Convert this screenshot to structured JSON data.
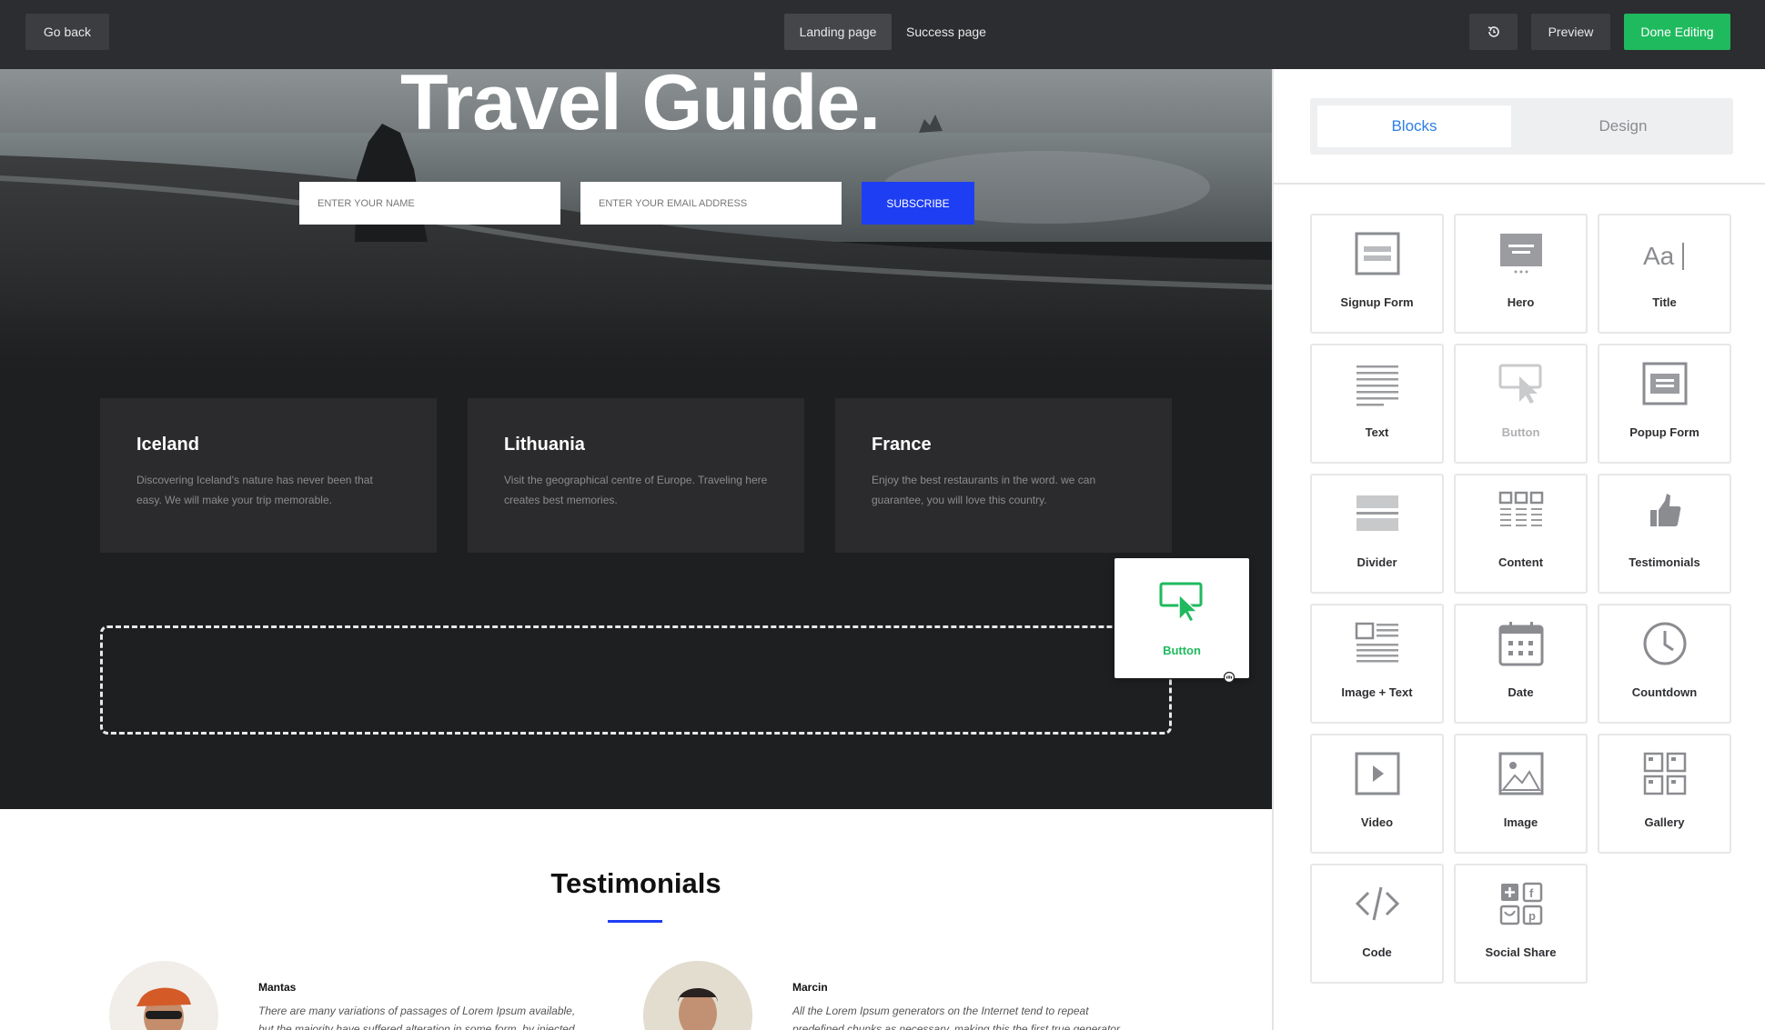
{
  "topbar": {
    "go_back": "Go back",
    "tabs": [
      {
        "label": "Landing page",
        "active": true
      },
      {
        "label": "Success page",
        "active": false
      }
    ],
    "history_icon": "history-icon",
    "preview": "Preview",
    "done": "Done Editing"
  },
  "hero": {
    "title": "Travel Guide.",
    "name_placeholder": "ENTER YOUR NAME",
    "email_placeholder": "ENTER YOUR EMAIL ADDRESS",
    "subscribe": "SUBSCRIBE"
  },
  "cards": [
    {
      "title": "Iceland",
      "text": "Discovering Iceland's nature has never been that easy. We will make your trip memorable."
    },
    {
      "title": "Lithuania",
      "text": "Visit the geographical centre of Europe. Traveling here creates best memories."
    },
    {
      "title": "France",
      "text": "Enjoy the best restaurants in the word. we can guarantee, you will love this country."
    }
  ],
  "drag": {
    "label": "Button",
    "icon": "cursor-click-icon"
  },
  "testimonials": {
    "title": "Testimonials",
    "items": [
      {
        "name": "Mantas",
        "text": "There are many variations of passages of Lorem Ipsum available, but the majority have suffered alteration in some form, by injected humour"
      },
      {
        "name": "Marcin",
        "text": "All the Lorem Ipsum generators on the Internet tend to repeat predefined chunks as necessary, making this the first true generator on"
      }
    ]
  },
  "sidebar": {
    "tabs": [
      {
        "label": "Blocks",
        "active": true
      },
      {
        "label": "Design",
        "active": false
      }
    ],
    "blocks": [
      {
        "label": "Signup Form",
        "icon": "signup-form-icon"
      },
      {
        "label": "Hero",
        "icon": "hero-icon"
      },
      {
        "label": "Title",
        "icon": "title-icon"
      },
      {
        "label": "Text",
        "icon": "text-icon"
      },
      {
        "label": "Button",
        "icon": "button-icon",
        "state": "dragging"
      },
      {
        "label": "Popup Form",
        "icon": "popup-form-icon"
      },
      {
        "label": "Divider",
        "icon": "divider-icon"
      },
      {
        "label": "Content",
        "icon": "content-icon"
      },
      {
        "label": "Testimonials",
        "icon": "thumbs-up-icon"
      },
      {
        "label": "Image + Text",
        "icon": "image-text-icon"
      },
      {
        "label": "Date",
        "icon": "calendar-icon"
      },
      {
        "label": "Countdown",
        "icon": "clock-icon"
      },
      {
        "label": "Video",
        "icon": "video-icon"
      },
      {
        "label": "Image",
        "icon": "image-icon"
      },
      {
        "label": "Gallery",
        "icon": "gallery-icon"
      },
      {
        "label": "Code",
        "icon": "code-icon"
      },
      {
        "label": "Social Share",
        "icon": "social-share-icon"
      }
    ]
  },
  "colors": {
    "topbar_bg": "#2c2d30",
    "done_green": "#1fba5e",
    "subscribe_blue": "#1e3ef3",
    "blocks_tab_blue": "#2d7ee8",
    "hero_bg": "#1e1f21"
  }
}
